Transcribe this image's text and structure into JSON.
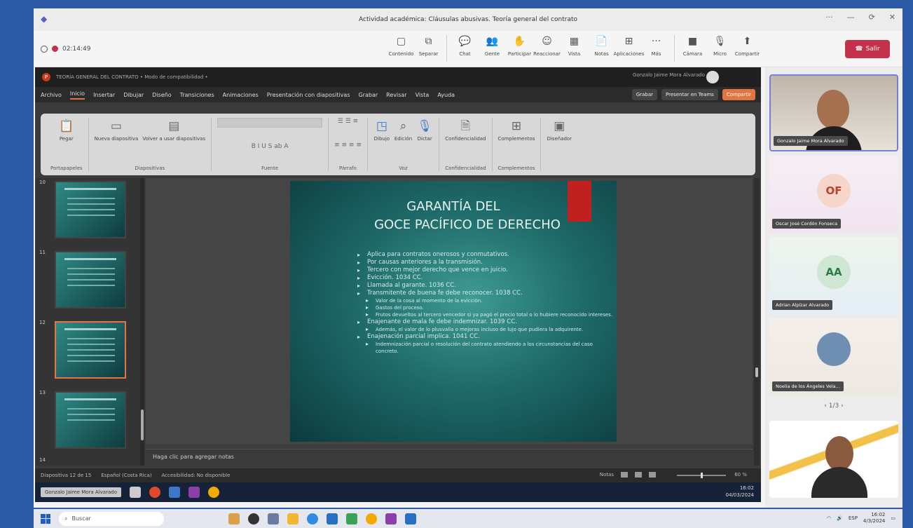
{
  "window": {
    "title": "Actividad académica: Cláusulas abusivas. Teoría general del contrato",
    "controls": [
      "···",
      "—",
      "⟳",
      "✕"
    ]
  },
  "teams": {
    "timer": "02:14:49",
    "tools": [
      {
        "label": "Contenido",
        "icon": "▢"
      },
      {
        "label": "Separar",
        "icon": "⧉"
      },
      {
        "label": "Chat",
        "icon": "💬"
      },
      {
        "label": "Gente",
        "icon": "👥"
      },
      {
        "label": "Participar",
        "icon": "✋"
      },
      {
        "label": "Reaccionar",
        "icon": "☺"
      },
      {
        "label": "Vista",
        "icon": "▦"
      },
      {
        "label": "Notas",
        "icon": "📄"
      },
      {
        "label": "Aplicaciones",
        "icon": "⊞"
      },
      {
        "label": "Más",
        "icon": "···"
      },
      {
        "label": "Cámara",
        "icon": "■"
      },
      {
        "label": "Micro",
        "icon": "🎙"
      },
      {
        "label": "Compartir",
        "icon": "⬆"
      }
    ],
    "leave_label": "Salir"
  },
  "ppt": {
    "filename": "TEORÍA GENERAL DEL CONTRATO • Modo de compatibilidad •",
    "user": "Gonzalo Jaime Mora Alvarado",
    "menus": [
      "Archivo",
      "Inicio",
      "Insertar",
      "Dibujar",
      "Diseño",
      "Transiciones",
      "Animaciones",
      "Presentación con diapositivas",
      "Grabar",
      "Revisar",
      "Vista",
      "Ayuda"
    ],
    "active_menu": "Inicio",
    "menu_buttons": {
      "grabar": "Grabar",
      "presentar": "Presentar en Teams",
      "compartir": "Compartir"
    },
    "ribbon_groups": [
      {
        "name": "Portapapeles",
        "items": [
          "Pegar"
        ]
      },
      {
        "name": "Diapositivas",
        "items": [
          "Nueva diapositiva",
          "Volver a usar diapositivas"
        ]
      },
      {
        "name": "Fuente",
        "items": []
      },
      {
        "name": "Párrafo",
        "items": []
      },
      {
        "name": "",
        "items": [
          "Dibujo",
          "Edición",
          "Dictar"
        ]
      },
      {
        "name": "Voz",
        "items": []
      },
      {
        "name": "Confidencialidad",
        "items": [
          "Confidencialidad"
        ]
      },
      {
        "name": "Complementos",
        "items": [
          "Complementos"
        ]
      },
      {
        "name": "",
        "items": [
          "Diseñador"
        ]
      }
    ],
    "thumbnails": [
      {
        "n": "10"
      },
      {
        "n": "11"
      },
      {
        "n": "12"
      },
      {
        "n": "13"
      },
      {
        "n": "14"
      }
    ],
    "slide": {
      "title_line1": "GARANTÍA DEL",
      "title_line2": "GOCE PACÍFICO DE DERECHO",
      "bullets": [
        {
          "t": "Aplica para contratos onerosos y conmutativos.",
          "sub": false
        },
        {
          "t": "Por causas anteriores a la transmisión.",
          "sub": false
        },
        {
          "t": "Tercero con mejor derecho que vence en juicio.",
          "sub": false
        },
        {
          "t": "Evicción. 1034 CC.",
          "sub": false
        },
        {
          "t": "Llamada al garante. 1036 CC.",
          "sub": false
        },
        {
          "t": "Transmitente de buena fe debe reconocer. 1038 CC.",
          "sub": false
        },
        {
          "t": "Valor de la cosa al momento de la evicción.",
          "sub": true
        },
        {
          "t": "Gastos del proceso.",
          "sub": true
        },
        {
          "t": "Frutos devueltos al tercero vencedor si ya pagó el precio total o lo hubiere reconocido intereses.",
          "sub": true
        },
        {
          "t": "Enajenante de mala fe debe indemnizar. 1039 CC.",
          "sub": false
        },
        {
          "t": "Además, el valor de lo plusvalía o mejoras incluso de lujo que pudiera la adquirente.",
          "sub": true
        },
        {
          "t": "Enajenación parcial implica. 1041 CC.",
          "sub": false
        },
        {
          "t": "Indemnización parcial o resolución del contrato atendiendo a los circunstancias del caso concreto.",
          "sub": true
        }
      ]
    },
    "notes_placeholder": "Haga clic para agregar notas",
    "status": {
      "slide": "Diapositiva 12 de 15",
      "lang": "Español (Costa Rica)",
      "access": "Accesibilidad: No disponible",
      "notes": "Notas",
      "zoom": "60 %"
    },
    "inner_taskbar": {
      "caption": "Gonzalo Jaime Mora Alvarado",
      "time": "16:02",
      "date": "04/03/2024"
    }
  },
  "participants": [
    {
      "initials": "",
      "name": "Gonzalo Jaime Mora Alvarado",
      "video": true
    },
    {
      "initials": "OF",
      "name": "Oscar José Cordón Fonseca",
      "video": false
    },
    {
      "initials": "AA",
      "name": "Adrian Alpízar Alvarado",
      "video": false
    },
    {
      "initials": "",
      "name": "Noelia de los Ángeles Vela...",
      "video": true
    },
    {
      "initials": "",
      "name": "",
      "video": true
    }
  ],
  "pager": "1/3",
  "taskbar": {
    "search_placeholder": "Buscar",
    "time": "16:02",
    "date": "4/3/2024",
    "lang": "ESP"
  }
}
